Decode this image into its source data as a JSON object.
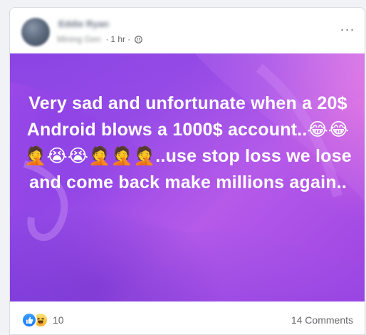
{
  "post": {
    "author_name": "Eddie Ryan",
    "meta_group": "Mining Gen",
    "time": "1 hr",
    "privacy_icon": "friends-icon",
    "more_label": "···",
    "text": "Very sad and unfortunate when a 20$ Android blows a 1000$ account..😂😂🤦😭😭🤦🤦🤦..use stop loss we lose and come back make millions again..",
    "background_colors": {
      "primary": "#a64ee8",
      "secondary": "#9548e6",
      "accent": "#ff78d2"
    }
  },
  "footer": {
    "reaction_icons": [
      "like-icon",
      "haha-icon"
    ],
    "reaction_count": "10",
    "comments_label": "14 Comments"
  }
}
